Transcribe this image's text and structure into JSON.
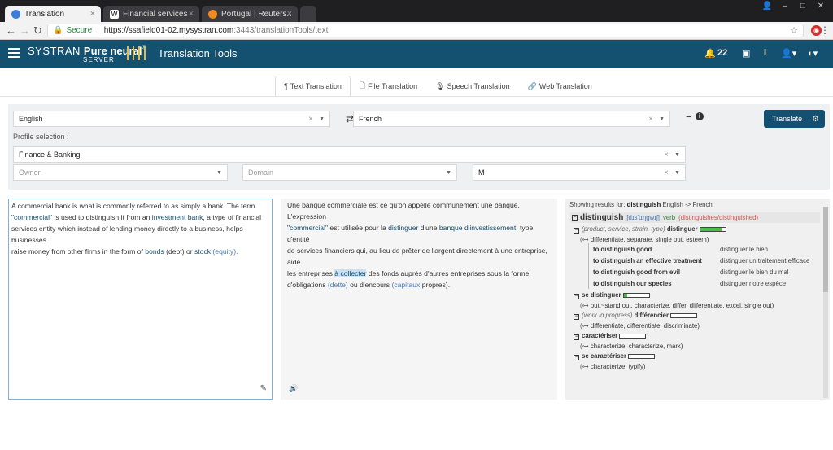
{
  "browser": {
    "tabs": [
      {
        "label": "Translation",
        "active": true
      },
      {
        "label": "Financial services - Wikip",
        "active": false
      },
      {
        "label": "Portugal | Reuters.com",
        "active": false
      }
    ],
    "secure_label": "Secure",
    "url_host": "https://ssafield01-02.mysystran.com",
    "url_path": ":3443/translationTools/text"
  },
  "app": {
    "brand_systran": "SYSTRAN",
    "brand_pn": "Pure neural",
    "brand_server": "SERVER",
    "title": "Translation Tools",
    "notif_count": "22"
  },
  "tool_tabs": [
    {
      "label": "Text Translation",
      "icon": "paragraph-icon"
    },
    {
      "label": "File Translation",
      "icon": "file-icon"
    },
    {
      "label": "Speech Translation",
      "icon": "microphone-icon"
    },
    {
      "label": "Web Translation",
      "icon": "link-icon"
    }
  ],
  "controls": {
    "source_lang": "English",
    "target_lang": "French",
    "translate_label": "Translate",
    "profile_label": "Profile selection :",
    "profile": "Finance & Banking",
    "owner_placeholder": "Owner",
    "domain_placeholder": "Domain",
    "m_value": "M"
  },
  "source_text": {
    "p1": "A commercial bank is what is commonly referred to as simply a bank. The term",
    "p2a": "\"commercial\"",
    "p2b": " is used to distinguish it from an ",
    "p2c": "investment bank",
    "p2d": ", a type of financial",
    "p3": "services entity which instead of lending money directly to a business, helps businesses",
    "p4a": "raise money from other firms in the form of ",
    "p4b": "bonds",
    "p4c": " (debt) or ",
    "p4d": "stock",
    "p4e": " (equity)."
  },
  "target_text": {
    "l1": "Une banque commerciale est ce qu'on appelle communément une banque. L'expression",
    "l2a": "\"commercial\"",
    "l2b": " est utilisée pour la ",
    "l2c": "distinguer",
    "l2d": " d'une ",
    "l2e": "banque d'investissement",
    "l2f": ", type d'entité",
    "l3": "de services financiers qui, au lieu de prêter de l'argent directement à une entreprise, aide",
    "l4a": "les entreprises ",
    "l4b": "à collecter",
    "l4c": " des fonds auprès d'autres entreprises sous la forme",
    "l5a": "d'obligations ",
    "l5b": "(dette)",
    "l5c": " ou d'encours ",
    "l5d": "(capitaux",
    "l5e": " propres)."
  },
  "dictionary": {
    "showing_prefix": "Showing results for:",
    "query": "distinguish",
    "direction": "English -> French",
    "headword": "distinguish",
    "phonetic": "[dɪs'tɪŋgwɪʃ]",
    "pos": "verb",
    "inflections": "(distinguishes/distinguished)",
    "senses": [
      {
        "ctx": "(product, service, strain, type)",
        "word": "distinguer",
        "fill": 0.85,
        "synonyms": "differentiate, separate, single out, esteem",
        "examples": [
          {
            "en": "to distinguish good",
            "fr": "distinguer le bien"
          },
          {
            "en": "to distinguish an effective treatment",
            "fr": "distinguer un traitement efficace"
          },
          {
            "en": "to distinguish good from evil",
            "fr": "distinguer le bien du mal"
          },
          {
            "en": "to distinguish our species",
            "fr": "distinguer notre espèce"
          }
        ]
      },
      {
        "ctx": "",
        "word": "se distinguer",
        "fill": 0.15,
        "synonyms": "out,~stand out, characterize, differ, differentiate, excel, single out",
        "examples": []
      },
      {
        "ctx": "(work in progress)",
        "word": "différencier",
        "fill": 0.0,
        "synonyms": "differentiate, differentiate, discriminate",
        "examples": []
      },
      {
        "ctx": "",
        "word": "caractériser",
        "fill": 0.0,
        "synonyms": "characterize, characterize, mark",
        "examples": []
      },
      {
        "ctx": "",
        "word": "se caractériser",
        "fill": 0.0,
        "synonyms": "characterize, typify",
        "examples": []
      }
    ]
  }
}
